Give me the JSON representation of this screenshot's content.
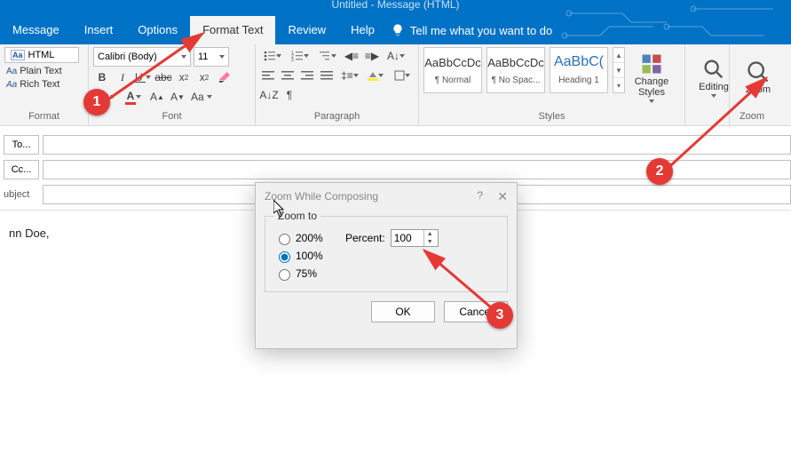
{
  "window": {
    "title": "Untitled - Message (HTML)"
  },
  "menu": {
    "message": "Message",
    "insert": "Insert",
    "options": "Options",
    "format_text": "Format Text",
    "review": "Review",
    "help": "Help",
    "tellme": "Tell me what you want to do"
  },
  "ribbon": {
    "format": {
      "label": "Format",
      "html": "HTML",
      "plain": "Plain Text",
      "rich": "Rich Text"
    },
    "font": {
      "label": "Font",
      "name": "Calibri (Body)",
      "size": "11"
    },
    "paragraph": {
      "label": "Paragraph"
    },
    "styles": {
      "label": "Styles",
      "tiles": [
        {
          "preview": "AaBbCcDc",
          "caption": "¶ Normal"
        },
        {
          "preview": "AaBbCcDc",
          "caption": "¶ No Spac..."
        },
        {
          "preview": "AaBbC(",
          "caption": "Heading 1",
          "big": true
        }
      ],
      "change": "Change Styles"
    },
    "editing": {
      "label": "Editing"
    },
    "zoom": {
      "label": "Zoom",
      "group": "Zoom"
    }
  },
  "compose": {
    "to": "To...",
    "cc": "Cc...",
    "subject": "ubject",
    "body": "nn Doe,"
  },
  "dialog": {
    "title": "Zoom While Composing",
    "legend": "Zoom to",
    "options": [
      "200%",
      "100%",
      "75%"
    ],
    "selected": "100%",
    "percent_label": "Percent:",
    "percent_value": "100",
    "ok": "OK",
    "cancel": "Cancel"
  },
  "annotations": {
    "a1": "1",
    "a2": "2",
    "a3": "3"
  }
}
